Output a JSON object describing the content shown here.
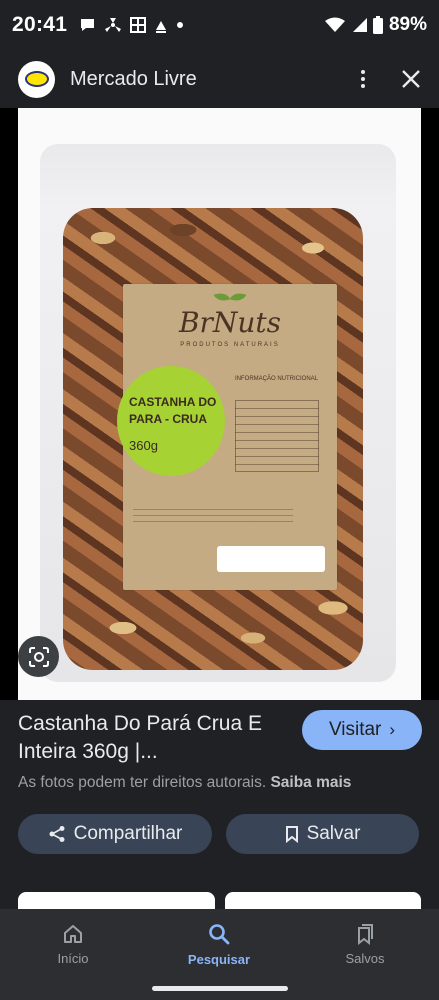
{
  "status_bar": {
    "time": "20:41",
    "battery": "89%",
    "icons": [
      "chat-icon",
      "fan-icon",
      "grid-icon",
      "upload-icon",
      "dot-icon",
      "wifi-icon",
      "signal-icon",
      "battery-icon"
    ]
  },
  "header": {
    "site_name": "Mercado Livre",
    "logo": "mercado-livre-handshake-logo"
  },
  "image": {
    "brand": "BrNuts",
    "brand_subtitle": "PRODUTOS NATURAIS",
    "product_label": "CASTANHA DO PARA - CRUA",
    "weight": "360g",
    "info_title": "INFORMAÇÃO NUTRICIONAL"
  },
  "details": {
    "title": "Castanha Do Pará Crua E Inteira 360g |...",
    "visit_label": "Visitar",
    "rights_text": "As fotos podem ter direitos autorais.",
    "learn_more": "Saiba mais",
    "share_label": "Compartilhar",
    "save_label": "Salvar"
  },
  "nav": {
    "items": [
      {
        "label": "Início",
        "icon": "home-icon",
        "active": false
      },
      {
        "label": "Pesquisar",
        "icon": "search-icon",
        "active": true
      },
      {
        "label": "Salvos",
        "icon": "bookmarks-icon",
        "active": false
      }
    ]
  },
  "colors": {
    "accent": "#8ab4f8",
    "background": "#202124",
    "chip": "#394457"
  }
}
